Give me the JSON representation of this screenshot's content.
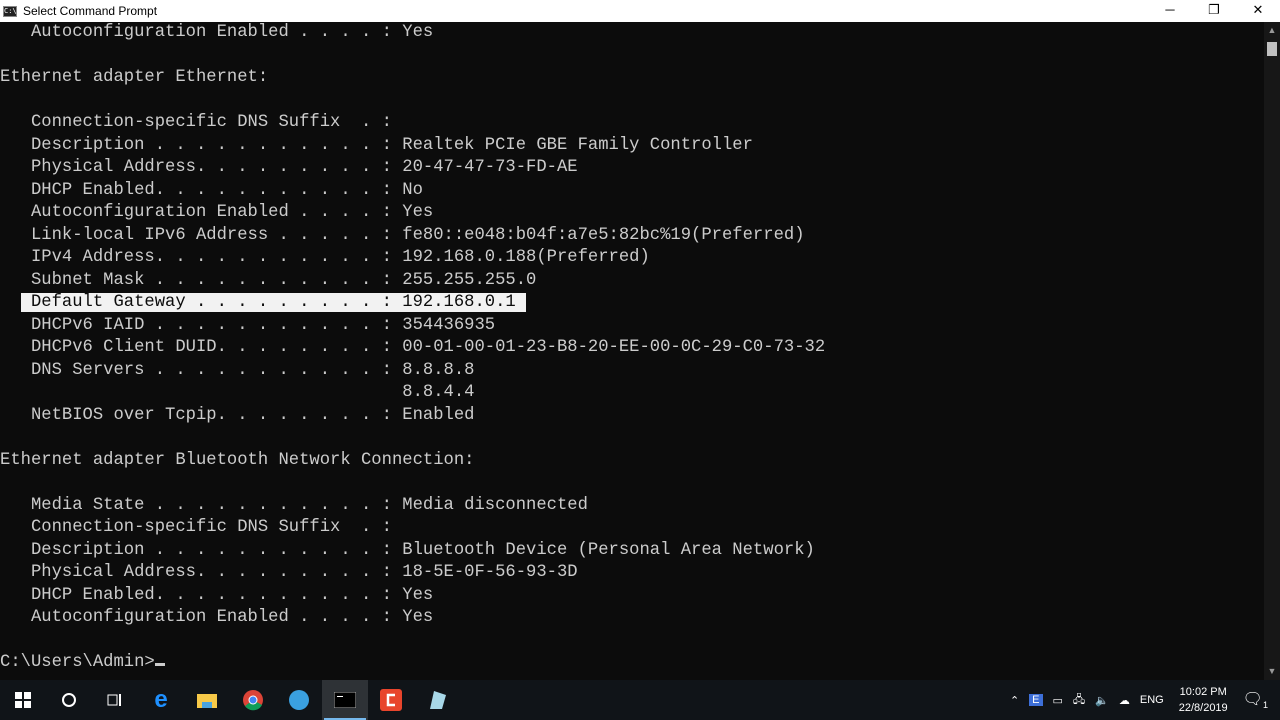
{
  "window": {
    "title": "Select Command Prompt",
    "icon": "cmd-icon",
    "minimize": "─",
    "restore": "❐",
    "close": "✕"
  },
  "console": {
    "lines": [
      "   Autoconfiguration Enabled . . . . : Yes",
      "",
      "Ethernet adapter Ethernet:",
      "",
      "   Connection-specific DNS Suffix  . :",
      "   Description . . . . . . . . . . . : Realtek PCIe GBE Family Controller",
      "   Physical Address. . . . . . . . . : 20-47-47-73-FD-AE",
      "   DHCP Enabled. . . . . . . . . . . : No",
      "   Autoconfiguration Enabled . . . . : Yes",
      "   Link-local IPv6 Address . . . . . : fe80::e048:b04f:a7e5:82bc%19(Preferred)",
      "   IPv4 Address. . . . . . . . . . . : 192.168.0.188(Preferred)",
      "   Subnet Mask . . . . . . . . . . . : 255.255.255.0",
      "",
      "   DHCPv6 IAID . . . . . . . . . . . : 354436935",
      "   DHCPv6 Client DUID. . . . . . . . : 00-01-00-01-23-B8-20-EE-00-0C-29-C0-73-32",
      "   DNS Servers . . . . . . . . . . . : 8.8.8.8",
      "                                       8.8.4.4",
      "   NetBIOS over Tcpip. . . . . . . . : Enabled",
      "",
      "Ethernet adapter Bluetooth Network Connection:",
      "",
      "   Media State . . . . . . . . . . . : Media disconnected",
      "   Connection-specific DNS Suffix  . :",
      "   Description . . . . . . . . . . . : Bluetooth Device (Personal Area Network)",
      "   Physical Address. . . . . . . . . : 18-5E-0F-56-93-3D",
      "   DHCP Enabled. . . . . . . . . . . : Yes",
      "   Autoconfiguration Enabled . . . . : Yes",
      ""
    ],
    "selected_line": {
      "index": 12,
      "before": "  ",
      "selected": " Default Gateway . . . . . . . . . : 192.168.0.1 ",
      "after": ""
    },
    "prompt": "C:\\Users\\Admin>"
  },
  "taskbar": {
    "apps": [
      "start",
      "cortana-search",
      "task-view",
      "edge",
      "file-explorer",
      "chrome",
      "browser",
      "command-prompt",
      "ccleaner",
      "notes"
    ],
    "tray": {
      "language": "ENG",
      "time": "10:02 PM",
      "date": "22/8/2019",
      "notifications": "1"
    }
  }
}
